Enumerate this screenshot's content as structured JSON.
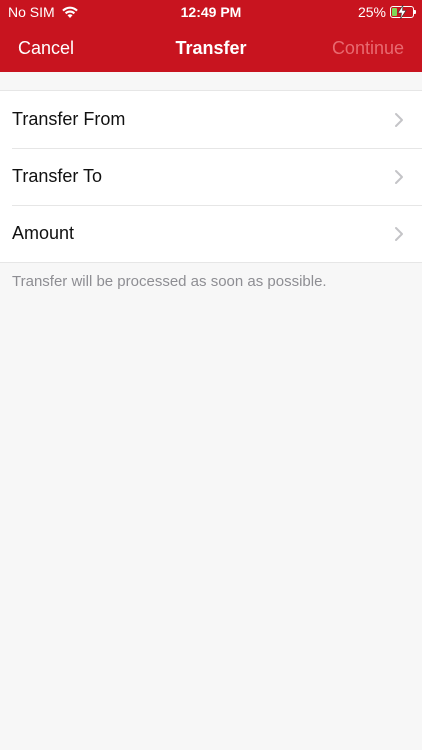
{
  "status_bar": {
    "carrier": "No SIM",
    "time": "12:49 PM",
    "battery": "25%",
    "battery_level": 0.25
  },
  "nav": {
    "cancel_label": "Cancel",
    "title": "Transfer",
    "continue_label": "Continue"
  },
  "rows": [
    {
      "label": "Transfer From"
    },
    {
      "label": "Transfer To"
    },
    {
      "label": "Amount"
    }
  ],
  "footnote": "Transfer will be processed as soon as possible.",
  "colors": {
    "header": "#c8141f",
    "disabled_text": "#e86a70",
    "secondary_text": "#8e8e93"
  },
  "icons": {
    "wifi": "wifi-icon",
    "battery": "battery-icon",
    "row_chevron": "chevron-right-icon"
  }
}
